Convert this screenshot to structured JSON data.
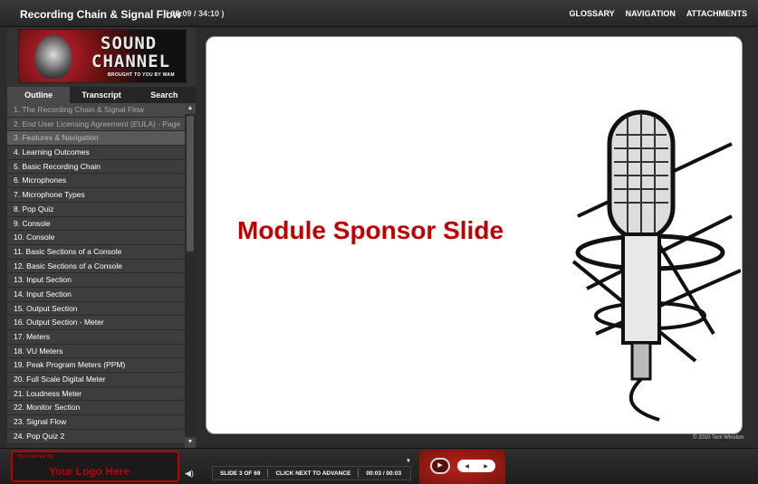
{
  "header": {
    "title": "Recording Chain & Signal Flow",
    "time": "( 00:09 / 34:10 )",
    "nav": [
      "GLOSSARY",
      "NAVIGATION",
      "ATTACHMENTS"
    ]
  },
  "logo": {
    "line1": "SOUND",
    "line2": "CHANNEL",
    "line3": "BROUGHT TO YOU BY WAM"
  },
  "sidebar": {
    "tabs": [
      "Outline",
      "Transcript",
      "Search"
    ],
    "items": [
      "1. The Recording Chain & Signal Flow",
      "2. End User Licensing Agreement (EULA) - Page",
      "3. Features & Navigation",
      "4. Learning Outcomes",
      "5. Basic Recording Chain",
      "6. Microphones",
      "7. Microphone Types",
      "8. Pop Quiz",
      "9. Console",
      "10.  Console",
      "11.  Basic Sections of a Console",
      "12.  Basic Sections of a Console",
      "13.  Input Section",
      "14.  Input Section",
      "15.  Output Section",
      "16.  Output Section - Meter",
      "17.  Meters",
      "18.  VU Meters",
      "19.  Peak Program Meters (PPM)",
      "20.  Full Scale Digital Meter",
      "21.  Loudness Meter",
      "22.  Monitor Section",
      "23.  Signal Flow",
      "24.  Pop Quiz 2"
    ]
  },
  "slide": {
    "title": "Module Sponsor Slide",
    "copyright": "© 2010 Terri Winston"
  },
  "footer": {
    "sponsor_label": "Sponsored by:",
    "sponsor_logo": "Your Logo Here",
    "slide_count": "SLIDE 3 OF 69",
    "instruction": "CLICK NEXT TO ADVANCE",
    "slide_time": "00:03 / 00:03"
  },
  "colors": {
    "accent": "#c00000",
    "background": "#2c2c2c"
  }
}
